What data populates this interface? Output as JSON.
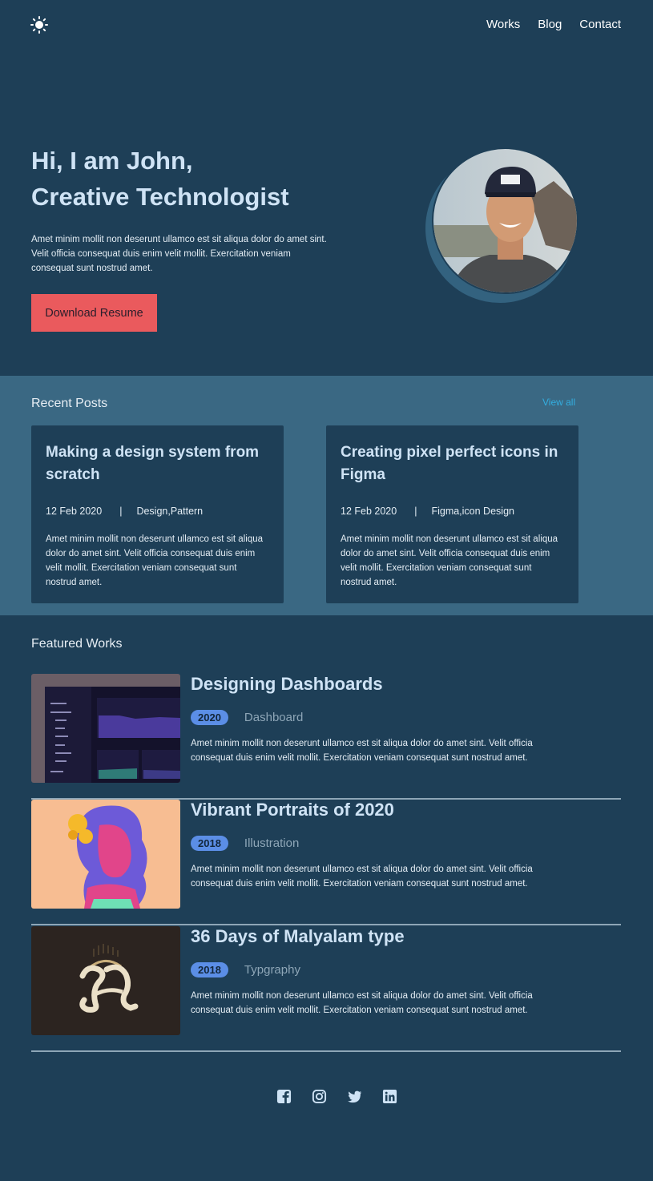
{
  "nav": {
    "theme_icon": "sun-icon",
    "links": [
      "Works",
      "Blog",
      "Contact"
    ]
  },
  "hero": {
    "title_line1": "Hi, I am John,",
    "title_line2": "Creative Technologist",
    "description": "Amet minim mollit non deserunt ullamco est sit aliqua dolor do amet sint. Velit officia consequat duis enim velit mollit. Exercitation veniam consequat sunt nostrud amet.",
    "button_label": "Download Resume",
    "avatar_icon": "profile-photo"
  },
  "recent_posts": {
    "title": "Recent Posts",
    "view_all": "View all",
    "posts": [
      {
        "title": "Making a design system from scratch",
        "date": "12 Feb 2020",
        "separator": "|",
        "tags": "Design,Pattern",
        "description": "Amet minim mollit non deserunt ullamco est sit aliqua dolor do amet sint. Velit officia consequat duis enim velit mollit. Exercitation veniam consequat sunt nostrud amet."
      },
      {
        "title": "Creating pixel perfect icons in Figma",
        "date": "12 Feb 2020",
        "separator": "|",
        "tags": "Figma,icon Design",
        "description": "Amet minim mollit non deserunt ullamco est sit aliqua dolor do amet sint. Velit officia consequat duis enim velit mollit. Exercitation veniam consequat sunt nostrud amet."
      }
    ]
  },
  "featured_works": {
    "title": "Featured Works",
    "works": [
      {
        "title": "Designing Dashboards",
        "year": "2020",
        "category": "Dashboard",
        "description": "Amet minim mollit non deserunt ullamco est sit aliqua dolor do amet sint. Velit officia consequat duis enim velit mollit. Exercitation veniam consequat sunt nostrud amet."
      },
      {
        "title": "Vibrant Portraits of 2020",
        "year": "2018",
        "category": "Illustration",
        "description": "Amet minim mollit non deserunt ullamco est sit aliqua dolor do amet sint. Velit officia consequat duis enim velit mollit. Exercitation veniam consequat sunt nostrud amet."
      },
      {
        "title": "36 Days of Malyalam type",
        "year": "2018",
        "category": "Typgraphy",
        "description": "Amet minim mollit non deserunt ullamco est sit aliqua dolor do amet sint. Velit officia consequat duis enim velit mollit. Exercitation veniam consequat sunt nostrud amet."
      }
    ]
  },
  "socials": [
    "facebook-icon",
    "instagram-icon",
    "twitter-icon",
    "linkedin-icon"
  ],
  "colors": {
    "background": "#1e3f57",
    "posts_band": "#3a6883",
    "accent_button": "#ea5a5d",
    "heading": "#cfe3f5",
    "badge": "#5b8ee6",
    "link": "#33aee0"
  }
}
